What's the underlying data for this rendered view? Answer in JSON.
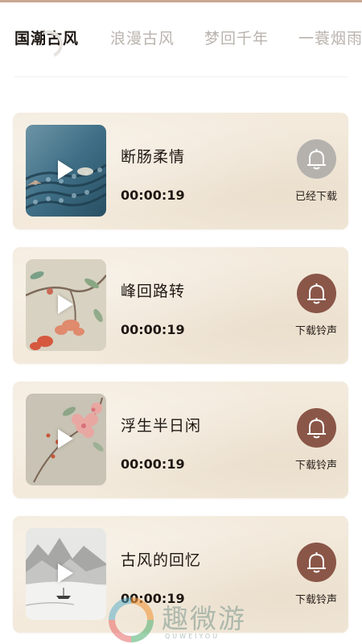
{
  "tabs": [
    {
      "label": "国潮古风",
      "active": true
    },
    {
      "label": "浪漫古风",
      "active": false
    },
    {
      "label": "梦回千年",
      "active": false
    },
    {
      "label": "一蓑烟雨",
      "active": false
    }
  ],
  "items": [
    {
      "title": "断肠柔情",
      "duration": "00:00:19",
      "action_label": "已经下载",
      "downloaded": true,
      "thumb": "blue-rooftop-tiles"
    },
    {
      "title": "峰回路转",
      "duration": "00:00:19",
      "action_label": "下载铃声",
      "downloaded": false,
      "thumb": "flower-branch-painting"
    },
    {
      "title": "浮生半日闲",
      "duration": "00:00:19",
      "action_label": "下载铃声",
      "downloaded": false,
      "thumb": "pink-blossom-painting"
    },
    {
      "title": "古风的回忆",
      "duration": "00:00:19",
      "action_label": "下载铃声",
      "downloaded": false,
      "thumb": "ink-landscape-boat"
    }
  ],
  "colors": {
    "active_tab": "#1c1712",
    "inactive_tab": "#b9b3ad",
    "card_bg": "#f3eadc",
    "bell_active": "#8a5648",
    "bell_downloaded": "#b5b2ae"
  },
  "watermark": {
    "text": "趣微游",
    "subtext": "QUWEIYOU"
  }
}
